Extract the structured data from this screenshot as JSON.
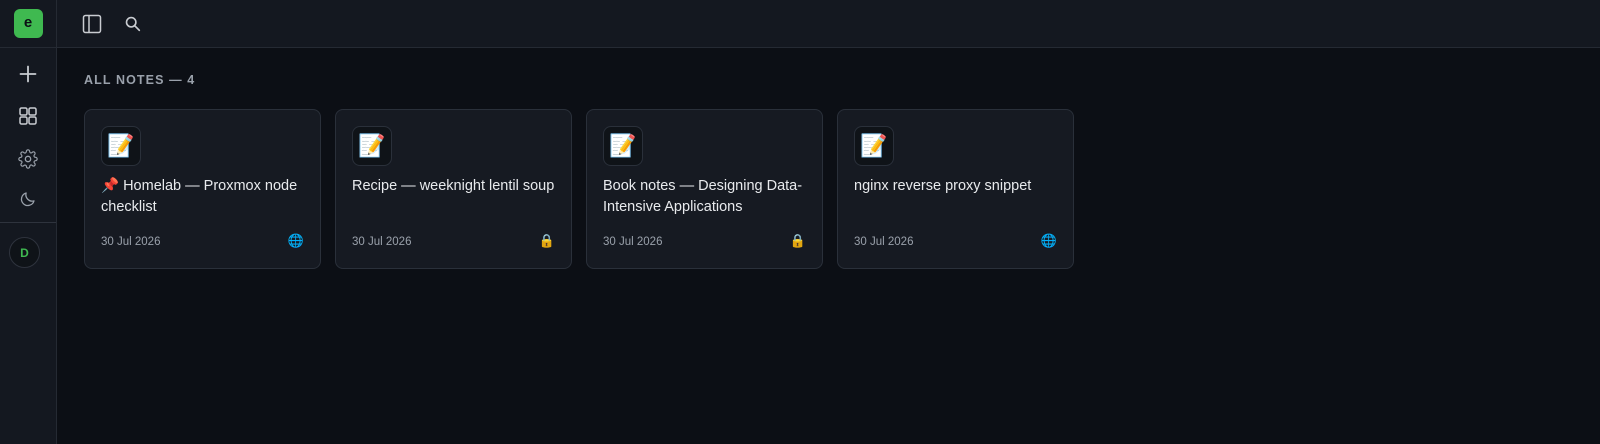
{
  "app": {
    "logo_letter": "e",
    "avatar_initial": "D"
  },
  "sidebar": {
    "items": [
      {
        "name": "new-note-button",
        "icon": "plus-icon"
      },
      {
        "name": "dashboard-button",
        "icon": "grid-icon"
      },
      {
        "name": "settings-button",
        "icon": "gear-icon"
      },
      {
        "name": "theme-toggle-button",
        "icon": "moon-icon"
      }
    ]
  },
  "topbar": {
    "buttons": [
      {
        "name": "toggle-sidebar-button",
        "icon": "sidebar-panel-icon"
      },
      {
        "name": "search-button",
        "icon": "search-icon"
      }
    ]
  },
  "main": {
    "section_label": "ALL NOTES — 4",
    "notes": [
      {
        "icon": "📝",
        "title": "📌 Homelab — Proxmox node checklist",
        "date": "30 Jul 2026",
        "visibility": "🌐",
        "visibility_icon": "globe-icon"
      },
      {
        "icon": "📝",
        "title": "Recipe — weeknight lentil soup",
        "date": "30 Jul 2026",
        "visibility": "🔒",
        "visibility_icon": "lock-icon"
      },
      {
        "icon": "📝",
        "title": "Book notes — Designing Data-Intensive Applications",
        "date": "30 Jul 2026",
        "visibility": "🔒",
        "visibility_icon": "lock-icon"
      },
      {
        "icon": "📝",
        "title": "nginx reverse proxy snippet",
        "date": "30 Jul 2026",
        "visibility": "🌐",
        "visibility_icon": "globe-icon"
      }
    ]
  },
  "colors": {
    "accent": "#3fb950",
    "background": "#0c0f15",
    "panel": "#141820",
    "card": "#161a22",
    "muted_text": "#9aa1ab"
  }
}
